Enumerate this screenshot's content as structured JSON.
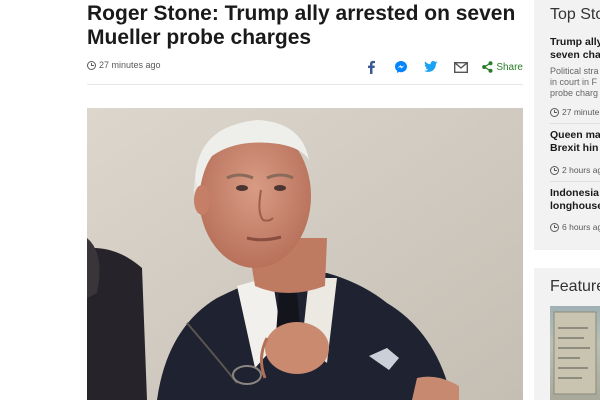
{
  "article": {
    "headline": "Roger Stone: Trump ally arrested on seven Mueller probe charges",
    "timestamp": "27 minutes ago"
  },
  "share": {
    "icons": [
      "facebook-icon",
      "messenger-icon",
      "twitter-icon",
      "email-icon",
      "share-icon"
    ],
    "label": "Share"
  },
  "photo": {
    "subject": "Roger Stone"
  },
  "sidebar": {
    "top_stories_title": "Top Sto",
    "stories": [
      {
        "title_line1": "Trump ally",
        "title_line2": "seven char",
        "desc_line1": "Political stra",
        "desc_line2": "in court in F",
        "desc_line3": "probe charg",
        "time": "27 minute"
      },
      {
        "title_line1": "Queen ma",
        "title_line2": "Brexit hin",
        "time": "2 hours ag"
      },
      {
        "title_line1": "Indonesia",
        "title_line2": "longhouse",
        "time": "6 hours ag"
      }
    ],
    "features_title": "Feature"
  },
  "colors": {
    "share_green": "#2a7d2a",
    "facebook_blue": "#3b5998",
    "twitter_blue": "#1da1f2",
    "messenger_blue": "#0084ff"
  }
}
